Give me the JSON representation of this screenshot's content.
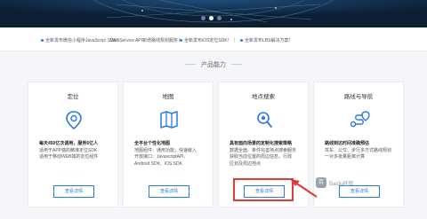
{
  "hero": {
    "carousel_dots": 3,
    "active_index": 1
  },
  "news": [
    "全新发布微信小程序JavaScript SDK！",
    "WebService API新增路线规划服务！",
    "全新发布iOS定位SDK！",
    "全新发布LBS解决方案！"
  ],
  "section": {
    "title": "产品能力"
  },
  "cards": [
    {
      "title": "定位",
      "icon": "location-pin-icon",
      "desc_strong": "每天450亿次调用，服务6亿人",
      "desc_lines": [
        "适用于APP端的精准定位SDK",
        "适用于移动WEB端的定位组件"
      ],
      "button": "查看详情"
    },
    {
      "title": "地图",
      "icon": "folded-map-icon",
      "desc_strong": "全平台个性化地图",
      "desc_lines": [
        "地图组件：通用功能，快速嵌入",
        "开放接口：JavascriptAPI、",
        "Android SDK、iOS SDK"
      ],
      "button": "查看详情"
    },
    {
      "title": "地点搜索",
      "icon": "search-pin-icon",
      "desc_strong": "具有面向场景的定制化搜索策略",
      "desc_lines": [
        "数据全面、条件完善地点搜索服务",
        "获取当前位置的周边信息，行政",
        "区划及周边地点"
      ],
      "button": "查看详情"
    },
    {
      "title": "路线与导航",
      "icon": "route-navigation-icon",
      "desc_strong": "路线到达时间准确预估",
      "desc_lines": [
        "驾车、公交、步行多方式路线规划",
        "一对多批量距离计算"
      ],
      "button": "查看详情"
    }
  ],
  "watermark": {
    "badge": "百",
    "text": "Baidu经验"
  },
  "colors": {
    "accent": "#2a7ae2",
    "highlight": "#e53935",
    "hero_bg": "#0c1f33"
  }
}
